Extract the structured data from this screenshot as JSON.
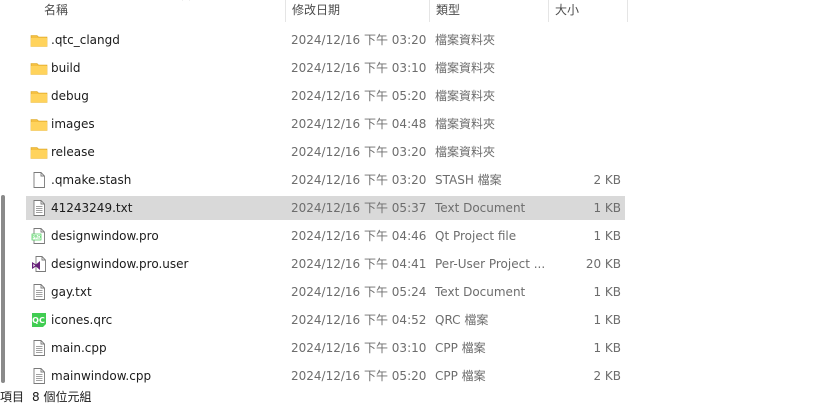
{
  "columns": {
    "name": "名稱",
    "date": "修改日期",
    "type": "類型",
    "size": "大小"
  },
  "files": [
    {
      "name": ".qtc_clangd",
      "date": "2024/12/16 下午 03:20",
      "type": "檔案資料夾",
      "size": "",
      "icon": "folder-icon"
    },
    {
      "name": "build",
      "date": "2024/12/16 下午 03:10",
      "type": "檔案資料夾",
      "size": "",
      "icon": "folder-icon"
    },
    {
      "name": "debug",
      "date": "2024/12/16 下午 05:20",
      "type": "檔案資料夾",
      "size": "",
      "icon": "folder-icon"
    },
    {
      "name": "images",
      "date": "2024/12/16 下午 04:48",
      "type": "檔案資料夾",
      "size": "",
      "icon": "folder-icon"
    },
    {
      "name": "release",
      "date": "2024/12/16 下午 03:20",
      "type": "檔案資料夾",
      "size": "",
      "icon": "folder-icon"
    },
    {
      "name": ".qmake.stash",
      "date": "2024/12/16 下午 03:20",
      "type": "STASH 檔案",
      "size": "2 KB",
      "icon": "blank-file-icon"
    },
    {
      "name": "41243249.txt",
      "date": "2024/12/16 下午 05:37",
      "type": "Text Document",
      "size": "1 KB",
      "icon": "text-file-icon",
      "selected": true
    },
    {
      "name": "designwindow.pro",
      "date": "2024/12/16 下午 04:46",
      "type": "Qt Project file",
      "size": "1 KB",
      "icon": "qt-project-file-icon"
    },
    {
      "name": "designwindow.pro.user",
      "date": "2024/12/16 下午 04:41",
      "type": "Per-User Project ...",
      "size": "20 KB",
      "icon": "visual-studio-file-icon"
    },
    {
      "name": "gay.txt",
      "date": "2024/12/16 下午 05:24",
      "type": "Text Document",
      "size": "1 KB",
      "icon": "text-file-icon"
    },
    {
      "name": "icones.qrc",
      "date": "2024/12/16 下午 04:52",
      "type": "QRC 檔案",
      "size": "1 KB",
      "icon": "qt-resource-file-icon"
    },
    {
      "name": "main.cpp",
      "date": "2024/12/16 下午 03:10",
      "type": "CPP 檔案",
      "size": "1 KB",
      "icon": "text-file-icon"
    },
    {
      "name": "mainwindow.cpp",
      "date": "2024/12/16 下午 05:20",
      "type": "CPP 檔案",
      "size": "2 KB",
      "icon": "text-file-icon"
    }
  ],
  "status": {
    "items_label": "項目",
    "count": "8 個位元組"
  },
  "colors": {
    "folder": "#f5c042",
    "selection": "#d9d9d9",
    "qt_green": "#41cd52",
    "vs_purple": "#68217a"
  }
}
